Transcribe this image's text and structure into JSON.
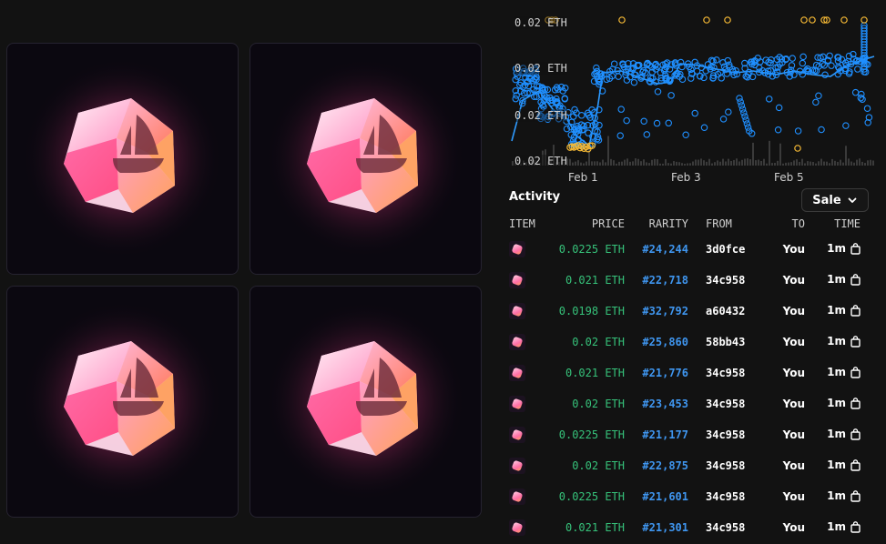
{
  "chart": {
    "y_ticks": [
      "0.02 ETH",
      "0.02 ETH",
      "0.02 ETH",
      "0.02 ETH"
    ],
    "x_ticks": [
      "Feb 1",
      "Feb 3",
      "Feb 5"
    ],
    "colors": {
      "listing": "#f5b935",
      "sale": "#1f8fff",
      "line": "#2f9bff",
      "volume": "#3a3a3a"
    }
  },
  "activity": {
    "title": "Activity",
    "filter_label": "Sale",
    "columns": {
      "item": "ITEM",
      "price": "PRICE",
      "rarity": "RARITY",
      "from": "FROM",
      "to": "TO",
      "time": "TIME"
    },
    "rows": [
      {
        "price": "0.0225 ETH",
        "rarity": "#24,244",
        "from": "3d0fce",
        "to": "You",
        "time": "1m"
      },
      {
        "price": "0.021 ETH",
        "rarity": "#22,718",
        "from": "34c958",
        "to": "You",
        "time": "1m"
      },
      {
        "price": "0.0198 ETH",
        "rarity": "#32,792",
        "from": "a60432",
        "to": "You",
        "time": "1m"
      },
      {
        "price": "0.02 ETH",
        "rarity": "#25,860",
        "from": "58bb43",
        "to": "You",
        "time": "1m"
      },
      {
        "price": "0.021 ETH",
        "rarity": "#21,776",
        "from": "34c958",
        "to": "You",
        "time": "1m"
      },
      {
        "price": "0.02 ETH",
        "rarity": "#23,453",
        "from": "34c958",
        "to": "You",
        "time": "1m"
      },
      {
        "price": "0.0225 ETH",
        "rarity": "#21,177",
        "from": "34c958",
        "to": "You",
        "time": "1m"
      },
      {
        "price": "0.02 ETH",
        "rarity": "#22,875",
        "from": "34c958",
        "to": "You",
        "time": "1m"
      },
      {
        "price": "0.0225 ETH",
        "rarity": "#21,601",
        "from": "34c958",
        "to": "You",
        "time": "1m"
      },
      {
        "price": "0.021 ETH",
        "rarity": "#21,301",
        "from": "34c958",
        "to": "You",
        "time": "1m"
      }
    ]
  }
}
